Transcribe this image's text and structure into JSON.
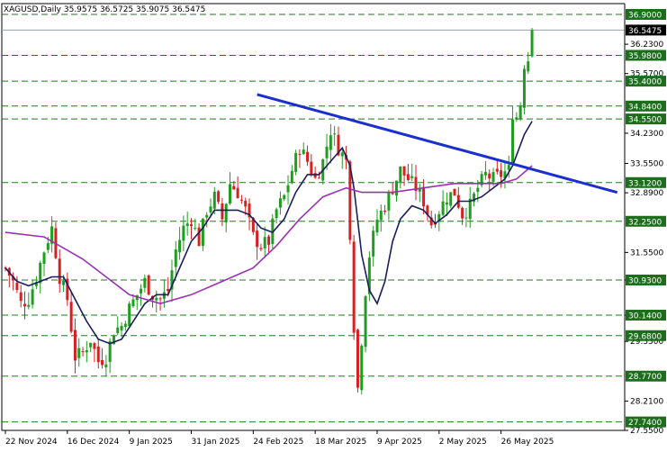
{
  "chart_data": {
    "type": "candlestick",
    "title": "XAGUSD,Daily  35.9575 36.5725 35.9075 36.5475",
    "ylim": [
      27.55,
      37.1
    ],
    "y_ticks": [
      "36.2300",
      "35.5700",
      "34.2300",
      "33.5500",
      "32.8900",
      "31.5500",
      "30.9300",
      "30.1400",
      "29.5500",
      "28.2100",
      "27.5500"
    ],
    "horizontal_levels": [
      36.9,
      35.98,
      35.4,
      34.84,
      34.55,
      33.12,
      32.25,
      30.93,
      30.14,
      29.68,
      28.77,
      27.74
    ],
    "level_labels": [
      "36.9000",
      "35.9800",
      "35.4000",
      "34.8400",
      "34.5500",
      "33.1200",
      "32.2500",
      "30.9300",
      "30.1400",
      "29.6800",
      "28.7700",
      "27.7400"
    ],
    "current_price": 36.5475,
    "current_price_label": "36.5475",
    "x_labels": [
      {
        "i": 0,
        "label": "22 Nov 2024"
      },
      {
        "i": 16,
        "label": "16 Dec 2024"
      },
      {
        "i": 32,
        "label": "9 Jan 2025"
      },
      {
        "i": 48,
        "label": "31 Jan 2025"
      },
      {
        "i": 64,
        "label": "24 Feb 2025"
      },
      {
        "i": 80,
        "label": "18 Mar 2025"
      },
      {
        "i": 96,
        "label": "9 Apr 2025"
      },
      {
        "i": 112,
        "label": "2 May 2025"
      },
      {
        "i": 128,
        "label": "26 May 2025"
      }
    ],
    "trendline": {
      "from": [
        65,
        35.1
      ],
      "to": [
        158,
        32.9
      ]
    },
    "close_path": [
      [
        0,
        31.2
      ],
      [
        2,
        30.9
      ],
      [
        4,
        30.4
      ],
      [
        6,
        30.5
      ],
      [
        8,
        31.0
      ],
      [
        10,
        31.6
      ],
      [
        12,
        32.1
      ],
      [
        14,
        31.0
      ],
      [
        16,
        30.5
      ],
      [
        18,
        29.2
      ],
      [
        20,
        29.3
      ],
      [
        22,
        29.6
      ],
      [
        24,
        29.1
      ],
      [
        26,
        29.2
      ],
      [
        28,
        29.8
      ],
      [
        30,
        29.9
      ],
      [
        32,
        30.3
      ],
      [
        34,
        30.6
      ],
      [
        36,
        30.9
      ],
      [
        38,
        30.6
      ],
      [
        40,
        30.5
      ],
      [
        42,
        30.7
      ],
      [
        44,
        31.6
      ],
      [
        46,
        32.1
      ],
      [
        48,
        32.3
      ],
      [
        50,
        31.8
      ],
      [
        52,
        32.5
      ],
      [
        54,
        32.8
      ],
      [
        56,
        32.3
      ],
      [
        58,
        33.1
      ],
      [
        60,
        32.9
      ],
      [
        62,
        32.5
      ],
      [
        64,
        31.9
      ],
      [
        66,
        31.7
      ],
      [
        68,
        31.8
      ],
      [
        70,
        32.5
      ],
      [
        72,
        32.8
      ],
      [
        74,
        33.4
      ],
      [
        76,
        33.9
      ],
      [
        78,
        33.6
      ],
      [
        80,
        33.2
      ],
      [
        82,
        33.6
      ],
      [
        84,
        34.3
      ],
      [
        86,
        33.9
      ],
      [
        88,
        33.6
      ],
      [
        89,
        32.0
      ],
      [
        90,
        29.9
      ],
      [
        91,
        28.5
      ],
      [
        92,
        29.6
      ],
      [
        93,
        30.7
      ],
      [
        94,
        31.5
      ],
      [
        96,
        32.3
      ],
      [
        98,
        32.6
      ],
      [
        100,
        33.0
      ],
      [
        102,
        33.4
      ],
      [
        104,
        33.2
      ],
      [
        106,
        33.0
      ],
      [
        108,
        32.7
      ],
      [
        110,
        32.2
      ],
      [
        112,
        32.5
      ],
      [
        114,
        32.8
      ],
      [
        116,
        32.9
      ],
      [
        118,
        32.4
      ],
      [
        120,
        32.6
      ],
      [
        122,
        33.0
      ],
      [
        124,
        33.3
      ],
      [
        126,
        33.2
      ],
      [
        128,
        33.3
      ],
      [
        130,
        33.4
      ],
      [
        131,
        34.7
      ],
      [
        132,
        34.6
      ],
      [
        133,
        34.9
      ],
      [
        134,
        35.8
      ],
      [
        135,
        35.9
      ],
      [
        136,
        36.55
      ]
    ],
    "series": [
      {
        "name": "",
        "color": "#1a1d5c",
        "points": [
          [
            0,
            31.2
          ],
          [
            3,
            30.9
          ],
          [
            6,
            30.8
          ],
          [
            9,
            30.9
          ],
          [
            12,
            31.0
          ],
          [
            15,
            31.0
          ],
          [
            18,
            30.5
          ],
          [
            21,
            30.0
          ],
          [
            24,
            29.6
          ],
          [
            27,
            29.5
          ],
          [
            30,
            29.6
          ],
          [
            33,
            30.0
          ],
          [
            36,
            30.4
          ],
          [
            39,
            30.6
          ],
          [
            42,
            30.6
          ],
          [
            45,
            31.2
          ],
          [
            48,
            31.8
          ],
          [
            51,
            32.1
          ],
          [
            54,
            32.5
          ],
          [
            57,
            32.5
          ],
          [
            60,
            32.5
          ],
          [
            63,
            32.4
          ],
          [
            66,
            32.1
          ],
          [
            69,
            32.0
          ],
          [
            72,
            32.3
          ],
          [
            75,
            32.9
          ],
          [
            78,
            33.3
          ],
          [
            81,
            33.3
          ],
          [
            84,
            33.6
          ],
          [
            87,
            33.9
          ],
          [
            89,
            33.5
          ],
          [
            90,
            33.0
          ],
          [
            92,
            31.5
          ],
          [
            94,
            30.7
          ],
          [
            96,
            30.4
          ],
          [
            98,
            30.9
          ],
          [
            100,
            31.8
          ],
          [
            102,
            32.3
          ],
          [
            105,
            32.6
          ],
          [
            108,
            32.5
          ],
          [
            111,
            32.2
          ],
          [
            114,
            32.4
          ],
          [
            117,
            32.7
          ],
          [
            120,
            32.7
          ],
          [
            123,
            32.8
          ],
          [
            126,
            33.0
          ],
          [
            129,
            33.2
          ],
          [
            131,
            33.5
          ],
          [
            134,
            34.2
          ],
          [
            136,
            34.5
          ]
        ]
      },
      {
        "name": "",
        "color": "#9b2fb5",
        "points": [
          [
            0,
            32.0
          ],
          [
            10,
            31.9
          ],
          [
            20,
            31.4
          ],
          [
            26,
            31.0
          ],
          [
            32,
            30.6
          ],
          [
            40,
            30.4
          ],
          [
            48,
            30.6
          ],
          [
            56,
            30.9
          ],
          [
            64,
            31.2
          ],
          [
            70,
            31.7
          ],
          [
            76,
            32.3
          ],
          [
            82,
            32.8
          ],
          [
            88,
            33.0
          ],
          [
            92,
            32.9
          ],
          [
            100,
            32.9
          ],
          [
            108,
            33.0
          ],
          [
            116,
            33.1
          ],
          [
            122,
            33.1
          ],
          [
            128,
            33.1
          ],
          [
            132,
            33.2
          ],
          [
            136,
            33.5
          ]
        ]
      }
    ]
  }
}
